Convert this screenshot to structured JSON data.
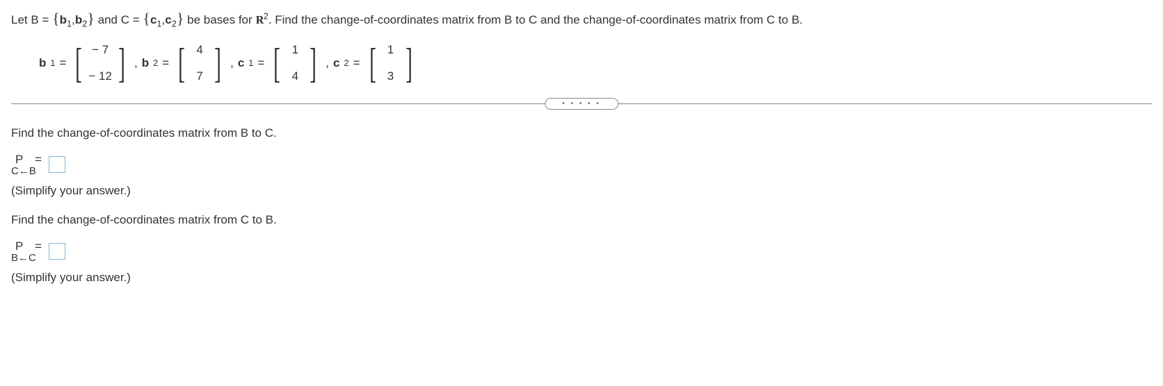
{
  "problem": {
    "text_pre": "Let B = ",
    "set_b_open": "{",
    "b1": "b",
    "b1_sub": "1",
    "comma1": ",",
    "b2": "b",
    "b2_sub": "2",
    "set_b_close": "}",
    "text_and": " and C = ",
    "set_c_open": "{",
    "c1": "c",
    "c1_sub": "1",
    "comma2": ",",
    "c2": "c",
    "c2_sub": "2",
    "set_c_close": "}",
    "text_bases": " be bases for ",
    "r_symbol": "R",
    "r_sup": "2",
    "text_end": ". Find the change-of-coordinates matrix from B to C and the change-of-coordinates matrix from C to B."
  },
  "vectors": {
    "b1_label": "b",
    "b1_sub": "1",
    "b1_eq": " = ",
    "b1_v1": "− 7",
    "b1_v2": "− 12",
    "sep1": ", ",
    "b2_label": "b",
    "b2_sub": "2",
    "b2_eq": " = ",
    "b2_v1": "4",
    "b2_v2": "7",
    "sep2": ", ",
    "c1_label": "c",
    "c1_sub": "1",
    "c1_eq": " = ",
    "c1_v1": "1",
    "c1_v2": "4",
    "sep3": ", ",
    "c2_label": "c",
    "c2_sub": "2",
    "c2_eq": " = ",
    "c2_v1": "1",
    "c2_v2": "3"
  },
  "divider": {
    "dots": "• • • • •"
  },
  "q1": {
    "text": "Find the change-of-coordinates matrix from B to C.",
    "p_label": "P",
    "eq": " = ",
    "sub_text": "C←B",
    "hint": "(Simplify your answer.)"
  },
  "q2": {
    "text": "Find the change-of-coordinates matrix from C to B.",
    "p_label": "P",
    "eq": " = ",
    "sub_text": "B←C",
    "hint": "(Simplify your answer.)"
  }
}
